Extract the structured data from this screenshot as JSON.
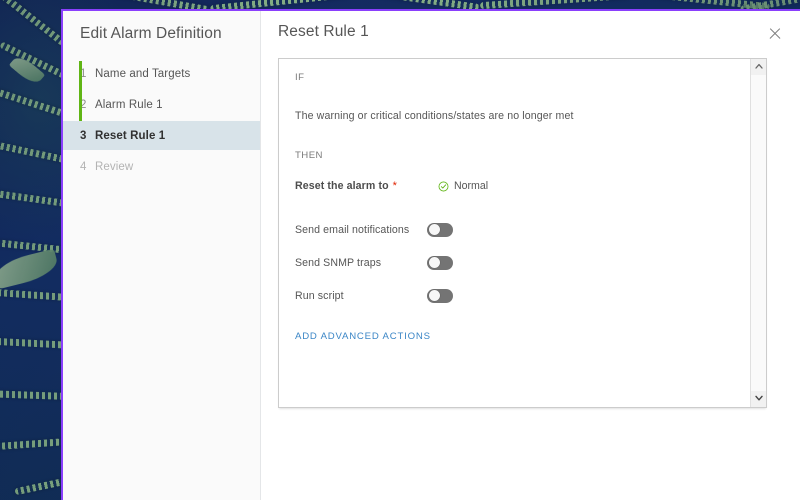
{
  "desktop": {
    "wallpaper_description": "fern-foliage-wallpaper"
  },
  "dialog": {
    "accent_color": "#8a3ffc",
    "wizard": {
      "title": "Edit Alarm Definition",
      "rail_color": "#60b515",
      "steps": [
        {
          "num": "1",
          "label": "Name and Targets",
          "state": "complete"
        },
        {
          "num": "2",
          "label": "Alarm Rule 1",
          "state": "complete"
        },
        {
          "num": "3",
          "label": "Reset Rule 1",
          "state": "active"
        },
        {
          "num": "4",
          "label": "Review",
          "state": "disabled"
        }
      ]
    },
    "content": {
      "title": "Reset Rule 1",
      "close_icon": "close-icon",
      "rule": {
        "if_keyword": "IF",
        "condition_text": "The warning or critical conditions/states are no longer met",
        "then_keyword": "THEN",
        "reset_label": "Reset the alarm to",
        "required_marker": "*",
        "required_color": "#e02200",
        "status": {
          "icon": "check-circle-icon",
          "label": "Normal",
          "color": "#60b515"
        },
        "toggles": [
          {
            "label": "Send email notifications",
            "on": false
          },
          {
            "label": "Send SNMP traps",
            "on": false
          },
          {
            "label": "Run script",
            "on": false
          }
        ],
        "advanced_link": "ADD ADVANCED ACTIONS",
        "link_color": "#3b86c6"
      },
      "scrollbar": {
        "up_icon": "chevron-up-icon",
        "down_icon": "chevron-down-icon"
      }
    }
  }
}
